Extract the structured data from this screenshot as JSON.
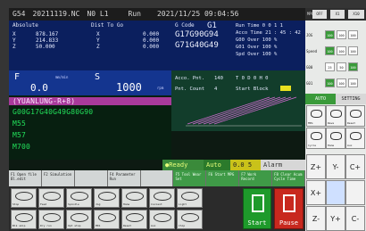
{
  "titlebar": {
    "id": "G54",
    "file": "20211119.NC",
    "block": "N0 L1",
    "mode": "Run",
    "datetime": "2021/11/25 09:04:56"
  },
  "position": {
    "absolute_label": "Absolute",
    "dist_label": "Dist To Go",
    "rows": [
      {
        "axis": "X",
        "abs": "878.167",
        "dist_axis": "X",
        "dist": "0.000"
      },
      {
        "axis": "Y",
        "abs": "214.833",
        "dist_axis": "Y",
        "dist": "0.000"
      },
      {
        "axis": "Z",
        "abs": "50.000",
        "dist_axis": "Z",
        "dist": "0.000"
      }
    ]
  },
  "codes": {
    "label": "G Code",
    "current": "G1",
    "line1": "G17G90G94",
    "line2": "G71G40G49",
    "run": [
      "Run Time  0  0  1  1",
      "Acco Time 21 : 45 : 42",
      "G00 Over      100 %",
      "G01 Over      100 %",
      "Spd Over      100 %"
    ]
  },
  "feed": {
    "f_label": "F",
    "f_value": "0.0",
    "f_unit": "mm/min",
    "s_label": "S",
    "s_value": "1000",
    "s_unit": "rpm"
  },
  "graph": {
    "acco_pnt": "Acco. Pnt.",
    "acco_val": "140",
    "tdh": "T  0  D  0  H  0",
    "pnt_count": "Pnt. Count",
    "pnt_val": "4",
    "start_block": "Start Block"
  },
  "program": {
    "lines": [
      "(YUANLUNG-R+8)",
      "G00G17G40G49G80G90",
      "M55",
      "M57",
      "M700"
    ]
  },
  "status": {
    "ready": "●Ready",
    "mode": "Auto",
    "zero": "0.0  5",
    "alarm": "Alarm"
  },
  "fkeys": [
    {
      "label": "F1 Open file Bl.edit"
    },
    {
      "label": "F2 Simulation"
    },
    {
      "label": ""
    },
    {
      "label": "F4 Parameter Run"
    },
    {
      "label": ""
    },
    {
      "label": "F5 Tool Wear Set"
    },
    {
      "label": "F6 Start MPG"
    },
    {
      "label": "F7 Work Record"
    },
    {
      "label": "F8 Clear Acum Cycle Time"
    }
  ],
  "bottom": {
    "row1": [
      "Stop",
      "Feed",
      "Spindle",
      "Jog",
      "Home",
      "Coolant",
      "Light"
    ],
    "row2": [
      "Blk skip",
      "Dry run",
      "Opt stop",
      "M01",
      "Reset",
      "Aux",
      "Chip"
    ],
    "start": "Start",
    "pause": "Pause"
  },
  "rpanel": {
    "title": "MPG",
    "buttons": [
      "OFF",
      "X1",
      "X10"
    ],
    "rows": [
      {
        "label": "JOG",
        "cells": [
          "100",
          "100",
          "100"
        ]
      },
      {
        "label": "Speed",
        "cells": [
          "100",
          "100",
          "100"
        ]
      },
      {
        "label": "G00",
        "cells": [
          "25",
          "50",
          "100"
        ]
      },
      {
        "label": "G01",
        "cells": [
          "100",
          "100",
          "100"
        ]
      }
    ],
    "tab_auto": "AUTO",
    "tab_setting": "SETTING",
    "tiles": [
      "MPG",
      "Wave",
      "Reset",
      "Cycle",
      "Home",
      "Aux"
    ],
    "jog": [
      "Z+",
      "Y-",
      "C+",
      "X+",
      "",
      "",
      "Z-",
      "Y+",
      "C-"
    ]
  }
}
